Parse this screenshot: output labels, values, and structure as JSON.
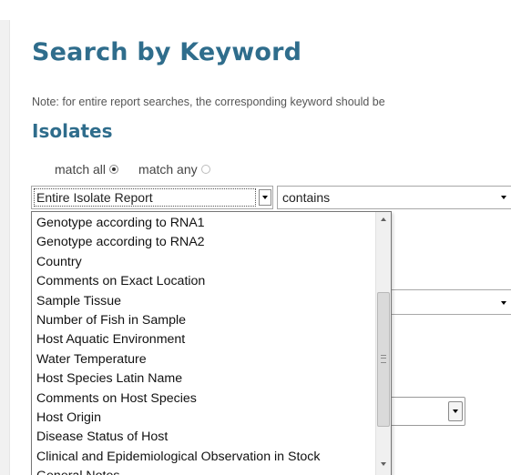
{
  "page": {
    "title": "Search by Keyword",
    "note": "Note: for entire report searches, the corresponding keyword should be",
    "section_title": "Isolates"
  },
  "match": {
    "all_label": "match all",
    "any_label": "match any",
    "selected": "all"
  },
  "field_select": {
    "value": "Entire Isolate Report"
  },
  "operator_select": {
    "value": "contains"
  },
  "field_options": [
    "Genotype according to RNA1",
    "Genotype according to RNA2",
    "Country",
    "Comments on Exact Location",
    "Sample Tissue",
    "Number of Fish in Sample",
    "Host Aquatic Environment",
    "Water Temperature",
    "Host Species Latin Name",
    "Comments on Host Species",
    "Host Origin",
    "Disease Status of Host",
    "Clinical and Epidemiological Observation in Stock",
    "General Notes"
  ],
  "icons": {
    "dropdown": "chevron-down-icon",
    "scroll_up": "scroll-up-arrow-icon",
    "scroll_down": "scroll-down-arrow-icon",
    "scroll_grip": "grip-icon"
  },
  "colors": {
    "heading": "#2f6d8c",
    "note_text": "#555555"
  }
}
